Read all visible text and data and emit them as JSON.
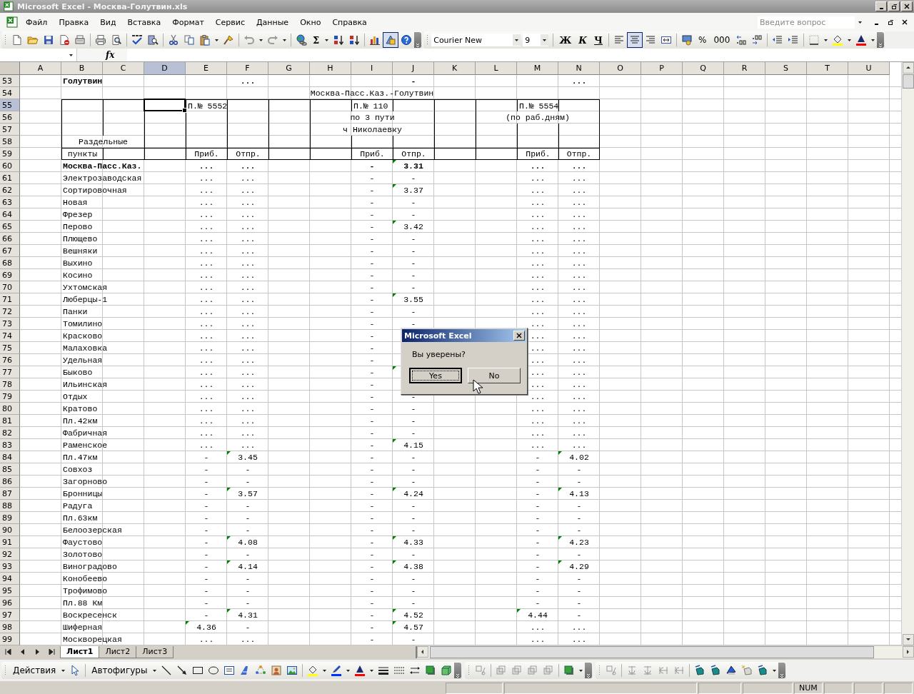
{
  "window": {
    "title": "Microsoft Excel - Москва-Голутвин.xls",
    "active": false
  },
  "menu": [
    "Файл",
    "Правка",
    "Вид",
    "Вставка",
    "Формат",
    "Сервис",
    "Данные",
    "Окно",
    "Справка"
  ],
  "help_box": {
    "placeholder": "Введите вопрос"
  },
  "standard_toolbar": {
    "sum": "Σ",
    "drawing_pressed": true
  },
  "formatting_toolbar": {
    "font": "Courier New",
    "size": "9",
    "bold": "Ж",
    "italic": "К",
    "underline": "Ч",
    "center_pressed": true,
    "percent": "%",
    "thousands": "000"
  },
  "formula_bar": {
    "function_label": "fx"
  },
  "columns": [
    {
      "label": "A",
      "selected": false
    },
    {
      "label": "B",
      "selected": false
    },
    {
      "label": "C",
      "selected": false
    },
    {
      "label": "D",
      "selected": true
    },
    {
      "label": "E",
      "selected": false
    },
    {
      "label": "F",
      "selected": false
    },
    {
      "label": "G",
      "selected": false
    },
    {
      "label": "H",
      "selected": false
    },
    {
      "label": "I",
      "selected": false
    },
    {
      "label": "J",
      "selected": false
    },
    {
      "label": "K",
      "selected": false
    },
    {
      "label": "L",
      "selected": false
    },
    {
      "label": "M",
      "selected": false
    },
    {
      "label": "N",
      "selected": false
    },
    {
      "label": "O",
      "selected": false
    },
    {
      "label": "P",
      "selected": false
    },
    {
      "label": "Q",
      "selected": false
    },
    {
      "label": "R",
      "selected": false
    },
    {
      "label": "S",
      "selected": false
    },
    {
      "label": "T",
      "selected": false
    },
    {
      "label": "U",
      "selected": false
    }
  ],
  "rows": [
    {
      "label": "53",
      "selected": false,
      "kind": "station",
      "bold": true,
      "name": "Голутвин",
      "cells": {
        "F": "...",
        "J": "-",
        "N": "..."
      },
      "flags": {
        "F": false,
        "J": false,
        "N": false
      }
    },
    {
      "label": "54",
      "selected": false,
      "kind": "caption",
      "texts": [
        "Москва-Пасс.Каз.-Голутвин"
      ]
    },
    {
      "label": "55",
      "selected": true,
      "kind": "header",
      "texts": [
        "П.№ 5552",
        "П.№ 110",
        "П.№ 5554"
      ]
    },
    {
      "label": "56",
      "selected": false,
      "kind": "header",
      "texts": [
        "по 3 пути",
        "(по раб.дням)"
      ]
    },
    {
      "label": "57",
      "selected": false,
      "kind": "header",
      "texts": [
        "ч Николаевку"
      ]
    },
    {
      "label": "58",
      "selected": false,
      "kind": "header",
      "texts": [
        "Раздельные"
      ]
    },
    {
      "label": "59",
      "selected": false,
      "kind": "subheader",
      "texts": [
        "пункты",
        "Приб.",
        "Отпр.",
        "Приб.",
        "Отпр.",
        "Приб.",
        "Отпр."
      ]
    },
    {
      "label": "60",
      "selected": false,
      "kind": "station",
      "bold": true,
      "name": "Москва-Пасс.Каз.",
      "cells": {
        "E": "...",
        "F": "...",
        "I": "-",
        "J": "3.31",
        "M": "...",
        "N": "..."
      },
      "flags": {
        "E": false,
        "F": false,
        "I": false,
        "J": true,
        "M": false,
        "N": false
      }
    },
    {
      "label": "61",
      "selected": false,
      "kind": "station",
      "bold": false,
      "name": "Электрозаводская",
      "cells": {
        "E": "...",
        "F": "...",
        "I": "-",
        "J": "-",
        "M": "...",
        "N": "..."
      },
      "flags": {
        "E": false,
        "F": false,
        "I": false,
        "J": false,
        "M": false,
        "N": false
      }
    },
    {
      "label": "62",
      "selected": false,
      "kind": "station",
      "bold": false,
      "name": "Сортировочная",
      "cells": {
        "E": "...",
        "F": "...",
        "I": "-",
        "J": "3.37",
        "M": "...",
        "N": "..."
      },
      "flags": {
        "E": false,
        "F": false,
        "I": false,
        "J": true,
        "M": false,
        "N": false
      }
    },
    {
      "label": "63",
      "selected": false,
      "kind": "station",
      "bold": false,
      "name": "Новая",
      "cells": {
        "E": "...",
        "F": "...",
        "I": "-",
        "J": "-",
        "M": "...",
        "N": "..."
      },
      "flags": {
        "E": false,
        "F": false,
        "I": false,
        "J": false,
        "M": false,
        "N": false
      }
    },
    {
      "label": "64",
      "selected": false,
      "kind": "station",
      "bold": false,
      "name": "Фрезер",
      "cells": {
        "E": "...",
        "F": "...",
        "I": "-",
        "J": "-",
        "M": "...",
        "N": "..."
      },
      "flags": {
        "E": false,
        "F": false,
        "I": false,
        "J": false,
        "M": false,
        "N": false
      }
    },
    {
      "label": "65",
      "selected": false,
      "kind": "station",
      "bold": false,
      "name": "Перово",
      "cells": {
        "E": "...",
        "F": "...",
        "I": "-",
        "J": "3.42",
        "M": "...",
        "N": "..."
      },
      "flags": {
        "E": false,
        "F": false,
        "I": false,
        "J": true,
        "M": false,
        "N": false
      }
    },
    {
      "label": "66",
      "selected": false,
      "kind": "station",
      "bold": false,
      "name": "Плющево",
      "cells": {
        "E": "...",
        "F": "...",
        "I": "-",
        "J": "-",
        "M": "...",
        "N": "..."
      },
      "flags": {
        "E": false,
        "F": false,
        "I": false,
        "J": false,
        "M": false,
        "N": false
      }
    },
    {
      "label": "67",
      "selected": false,
      "kind": "station",
      "bold": false,
      "name": "Вешняки",
      "cells": {
        "E": "...",
        "F": "...",
        "I": "-",
        "J": "-",
        "M": "...",
        "N": "..."
      },
      "flags": {
        "E": false,
        "F": false,
        "I": false,
        "J": false,
        "M": false,
        "N": false
      }
    },
    {
      "label": "68",
      "selected": false,
      "kind": "station",
      "bold": false,
      "name": "Выхино",
      "cells": {
        "E": "...",
        "F": "...",
        "I": "-",
        "J": "-",
        "M": "...",
        "N": "..."
      },
      "flags": {
        "E": false,
        "F": false,
        "I": false,
        "J": false,
        "M": false,
        "N": false
      }
    },
    {
      "label": "69",
      "selected": false,
      "kind": "station",
      "bold": false,
      "name": "Косино",
      "cells": {
        "E": "...",
        "F": "...",
        "I": "-",
        "J": "-",
        "M": "...",
        "N": "..."
      },
      "flags": {
        "E": false,
        "F": false,
        "I": false,
        "J": false,
        "M": false,
        "N": false
      }
    },
    {
      "label": "70",
      "selected": false,
      "kind": "station",
      "bold": false,
      "name": "Ухтомская",
      "cells": {
        "E": "...",
        "F": "...",
        "I": "-",
        "J": "-",
        "M": "...",
        "N": "..."
      },
      "flags": {
        "E": false,
        "F": false,
        "I": false,
        "J": false,
        "M": false,
        "N": false
      }
    },
    {
      "label": "71",
      "selected": false,
      "kind": "station",
      "bold": false,
      "name": "Люберцы-1",
      "cells": {
        "E": "...",
        "F": "...",
        "I": "-",
        "J": "3.55",
        "M": "...",
        "N": "..."
      },
      "flags": {
        "E": false,
        "F": false,
        "I": false,
        "J": true,
        "M": false,
        "N": false
      }
    },
    {
      "label": "72",
      "selected": false,
      "kind": "station",
      "bold": false,
      "name": "Панки",
      "cells": {
        "E": "...",
        "F": "...",
        "I": "-",
        "J": "-",
        "M": "...",
        "N": "..."
      },
      "flags": {
        "E": false,
        "F": false,
        "I": false,
        "J": false,
        "M": false,
        "N": false
      }
    },
    {
      "label": "73",
      "selected": false,
      "kind": "station",
      "bold": false,
      "name": "Томилино",
      "cells": {
        "E": "...",
        "F": "...",
        "I": "-",
        "J": "-",
        "M": "...",
        "N": "..."
      },
      "flags": {
        "E": false,
        "F": false,
        "I": false,
        "J": false,
        "M": false,
        "N": false
      }
    },
    {
      "label": "74",
      "selected": false,
      "kind": "station",
      "bold": false,
      "name": "Красково",
      "cells": {
        "E": "...",
        "F": "...",
        "I": "-",
        "M": "...",
        "N": "..."
      },
      "flags": {
        "E": false,
        "F": false,
        "I": false,
        "M": false,
        "N": false
      }
    },
    {
      "label": "75",
      "selected": false,
      "kind": "station",
      "bold": false,
      "name": "Малаховка",
      "cells": {
        "E": "...",
        "F": "...",
        "I": "-",
        "M": "...",
        "N": "..."
      },
      "flags": {
        "E": false,
        "F": false,
        "I": false,
        "M": false,
        "N": false
      }
    },
    {
      "label": "76",
      "selected": false,
      "kind": "station",
      "bold": false,
      "name": "Удельная",
      "cells": {
        "E": "...",
        "F": "...",
        "I": "-",
        "M": "...",
        "N": "..."
      },
      "flags": {
        "E": false,
        "F": false,
        "I": false,
        "M": false,
        "N": false
      }
    },
    {
      "label": "77",
      "selected": false,
      "kind": "station",
      "bold": false,
      "name": "Быково",
      "cells": {
        "E": "...",
        "F": "...",
        "I": "-",
        "M": "...",
        "N": "..."
      },
      "flags": {
        "E": false,
        "F": false,
        "I": false,
        "J": true,
        "M": false,
        "N": false
      }
    },
    {
      "label": "78",
      "selected": false,
      "kind": "station",
      "bold": false,
      "name": "Ильинская",
      "cells": {
        "E": "...",
        "F": "...",
        "I": "-",
        "M": "...",
        "N": "..."
      },
      "flags": {
        "E": false,
        "F": false,
        "I": false,
        "M": false,
        "N": false
      }
    },
    {
      "label": "79",
      "selected": false,
      "kind": "station",
      "bold": false,
      "name": "Отдых",
      "cells": {
        "E": "...",
        "F": "...",
        "I": "-",
        "J": "-",
        "M": "...",
        "N": "..."
      },
      "flags": {
        "E": false,
        "F": false,
        "I": false,
        "J": false,
        "M": false,
        "N": false
      }
    },
    {
      "label": "80",
      "selected": false,
      "kind": "station",
      "bold": false,
      "name": "Кратово",
      "cells": {
        "E": "...",
        "F": "...",
        "I": "-",
        "J": "-",
        "M": "...",
        "N": "..."
      },
      "flags": {
        "E": false,
        "F": false,
        "I": false,
        "J": false,
        "M": false,
        "N": false
      }
    },
    {
      "label": "81",
      "selected": false,
      "kind": "station",
      "bold": false,
      "name": "Пл.42км",
      "cells": {
        "E": "...",
        "F": "...",
        "I": "-",
        "J": "-",
        "M": "...",
        "N": "..."
      },
      "flags": {
        "E": false,
        "F": false,
        "I": false,
        "J": false,
        "M": false,
        "N": false
      }
    },
    {
      "label": "82",
      "selected": false,
      "kind": "station",
      "bold": false,
      "name": "Фабричная",
      "cells": {
        "E": "...",
        "F": "...",
        "I": "-",
        "J": "-",
        "M": "...",
        "N": "..."
      },
      "flags": {
        "E": false,
        "F": false,
        "I": false,
        "J": false,
        "M": false,
        "N": false
      }
    },
    {
      "label": "83",
      "selected": false,
      "kind": "station",
      "bold": false,
      "name": "Раменское",
      "cells": {
        "E": "...",
        "F": "...",
        "I": "-",
        "J": "4.15",
        "M": "...",
        "N": "..."
      },
      "flags": {
        "E": false,
        "F": false,
        "I": false,
        "J": true,
        "M": false,
        "N": false
      }
    },
    {
      "label": "84",
      "selected": false,
      "kind": "station",
      "bold": false,
      "name": "Пл.47км",
      "cells": {
        "E": "-",
        "F": "3.45",
        "I": "-",
        "J": "-",
        "M": "-",
        "N": "4.02"
      },
      "flags": {
        "E": false,
        "F": true,
        "I": false,
        "J": false,
        "M": false,
        "N": true
      }
    },
    {
      "label": "85",
      "selected": false,
      "kind": "station",
      "bold": false,
      "name": "Совхоз",
      "cells": {
        "E": "-",
        "F": "-",
        "I": "-",
        "J": "-",
        "M": "-",
        "N": "-"
      },
      "flags": {
        "E": false,
        "F": false,
        "I": false,
        "J": false,
        "M": false,
        "N": false
      }
    },
    {
      "label": "86",
      "selected": false,
      "kind": "station",
      "bold": false,
      "name": "Загорново",
      "cells": {
        "E": "-",
        "F": "-",
        "I": "-",
        "J": "-",
        "M": "-",
        "N": "-"
      },
      "flags": {
        "E": false,
        "F": false,
        "I": false,
        "J": false,
        "M": false,
        "N": false
      }
    },
    {
      "label": "87",
      "selected": false,
      "kind": "station",
      "bold": false,
      "name": "Бронницы",
      "cells": {
        "E": "-",
        "F": "3.57",
        "I": "-",
        "J": "4.24",
        "M": "-",
        "N": "4.13"
      },
      "flags": {
        "E": false,
        "F": true,
        "I": false,
        "J": true,
        "M": false,
        "N": true
      }
    },
    {
      "label": "88",
      "selected": false,
      "kind": "station",
      "bold": false,
      "name": "Радуга",
      "cells": {
        "E": "-",
        "F": "-",
        "I": "-",
        "J": "-",
        "M": "-",
        "N": "-"
      },
      "flags": {
        "E": false,
        "F": false,
        "I": false,
        "J": false,
        "M": false,
        "N": false
      }
    },
    {
      "label": "89",
      "selected": false,
      "kind": "station",
      "bold": false,
      "name": "Пл.63км",
      "cells": {
        "E": "-",
        "F": "-",
        "I": "-",
        "J": "-",
        "M": "-",
        "N": "-"
      },
      "flags": {
        "E": false,
        "F": false,
        "I": false,
        "J": false,
        "M": false,
        "N": false
      }
    },
    {
      "label": "90",
      "selected": false,
      "kind": "station",
      "bold": false,
      "name": "Белоозерская",
      "cells": {
        "E": "-",
        "F": "-",
        "I": "-",
        "J": "-",
        "M": "-",
        "N": "-"
      },
      "flags": {
        "E": false,
        "F": false,
        "I": false,
        "J": false,
        "M": false,
        "N": false
      }
    },
    {
      "label": "91",
      "selected": false,
      "kind": "station",
      "bold": false,
      "name": "Фаустово",
      "cells": {
        "E": "-",
        "F": "4.08",
        "I": "-",
        "J": "4.33",
        "M": "-",
        "N": "4.23"
      },
      "flags": {
        "E": false,
        "F": true,
        "I": false,
        "J": true,
        "M": false,
        "N": true
      }
    },
    {
      "label": "92",
      "selected": false,
      "kind": "station",
      "bold": false,
      "name": "Золотово",
      "cells": {
        "E": "-",
        "F": "-",
        "I": "-",
        "J": "-",
        "M": "-",
        "N": "-"
      },
      "flags": {
        "E": false,
        "F": false,
        "I": false,
        "J": false,
        "M": false,
        "N": false
      }
    },
    {
      "label": "93",
      "selected": false,
      "kind": "station",
      "bold": false,
      "name": "Виноградово",
      "cells": {
        "E": "-",
        "F": "4.14",
        "I": "-",
        "J": "4.38",
        "M": "-",
        "N": "4.29"
      },
      "flags": {
        "E": false,
        "F": true,
        "I": false,
        "J": true,
        "M": false,
        "N": true
      }
    },
    {
      "label": "94",
      "selected": false,
      "kind": "station",
      "bold": false,
      "name": "Конобеево",
      "cells": {
        "E": "-",
        "F": "-",
        "I": "-",
        "J": "-",
        "M": "-",
        "N": "-"
      },
      "flags": {
        "E": false,
        "F": false,
        "I": false,
        "J": false,
        "M": false,
        "N": false
      }
    },
    {
      "label": "95",
      "selected": false,
      "kind": "station",
      "bold": false,
      "name": "Трофимово",
      "cells": {
        "E": "-",
        "F": "-",
        "I": "-",
        "J": "-",
        "M": "-",
        "N": "-"
      },
      "flags": {
        "E": false,
        "F": false,
        "I": false,
        "J": false,
        "M": false,
        "N": false
      }
    },
    {
      "label": "96",
      "selected": false,
      "kind": "station",
      "bold": false,
      "name": "Пл.88 Км",
      "cells": {
        "E": "-",
        "F": "-",
        "I": "-",
        "J": "-",
        "M": "-",
        "N": "-"
      },
      "flags": {
        "E": false,
        "F": false,
        "I": false,
        "J": false,
        "M": false,
        "N": false
      }
    },
    {
      "label": "97",
      "selected": false,
      "kind": "station",
      "bold": false,
      "name": "Воскресенск",
      "cells": {
        "E": "-",
        "F": "4.31",
        "I": "-",
        "J": "4.52",
        "M": "4.44",
        "N": "-"
      },
      "flags": {
        "E": false,
        "F": true,
        "I": false,
        "J": true,
        "M": true,
        "N": false
      }
    },
    {
      "label": "98",
      "selected": false,
      "kind": "station",
      "bold": false,
      "name": "Шиферная",
      "cells": {
        "E": "4.36",
        "F": "-",
        "I": "-",
        "J": "4.57",
        "M": "...",
        "N": "..."
      },
      "flags": {
        "E": true,
        "F": false,
        "I": false,
        "J": true,
        "M": false,
        "N": false
      }
    },
    {
      "label": "99",
      "selected": false,
      "kind": "station",
      "bold": false,
      "name": "Москворецкая",
      "cells": {
        "E": "...",
        "F": "...",
        "I": "-",
        "J": "-",
        "M": "...",
        "N": "..."
      },
      "flags": {
        "E": false,
        "F": false,
        "I": false,
        "J": false,
        "M": false,
        "N": false
      }
    }
  ],
  "sheet_tabs": [
    {
      "label": "Лист1",
      "selected": true
    },
    {
      "label": "Лист2",
      "selected": false
    },
    {
      "label": "Лист3",
      "selected": false
    }
  ],
  "drawing_toolbar": {
    "actions": "Действия",
    "autoshapes": "Автофигуры"
  },
  "status_bar": {
    "indicator": "NUM"
  },
  "dialog": {
    "title": "Microsoft Excel",
    "message": "Вы уверены?",
    "buttons": [
      {
        "label": "Yes",
        "focused": true
      },
      {
        "label": "No",
        "focused": false
      }
    ]
  }
}
